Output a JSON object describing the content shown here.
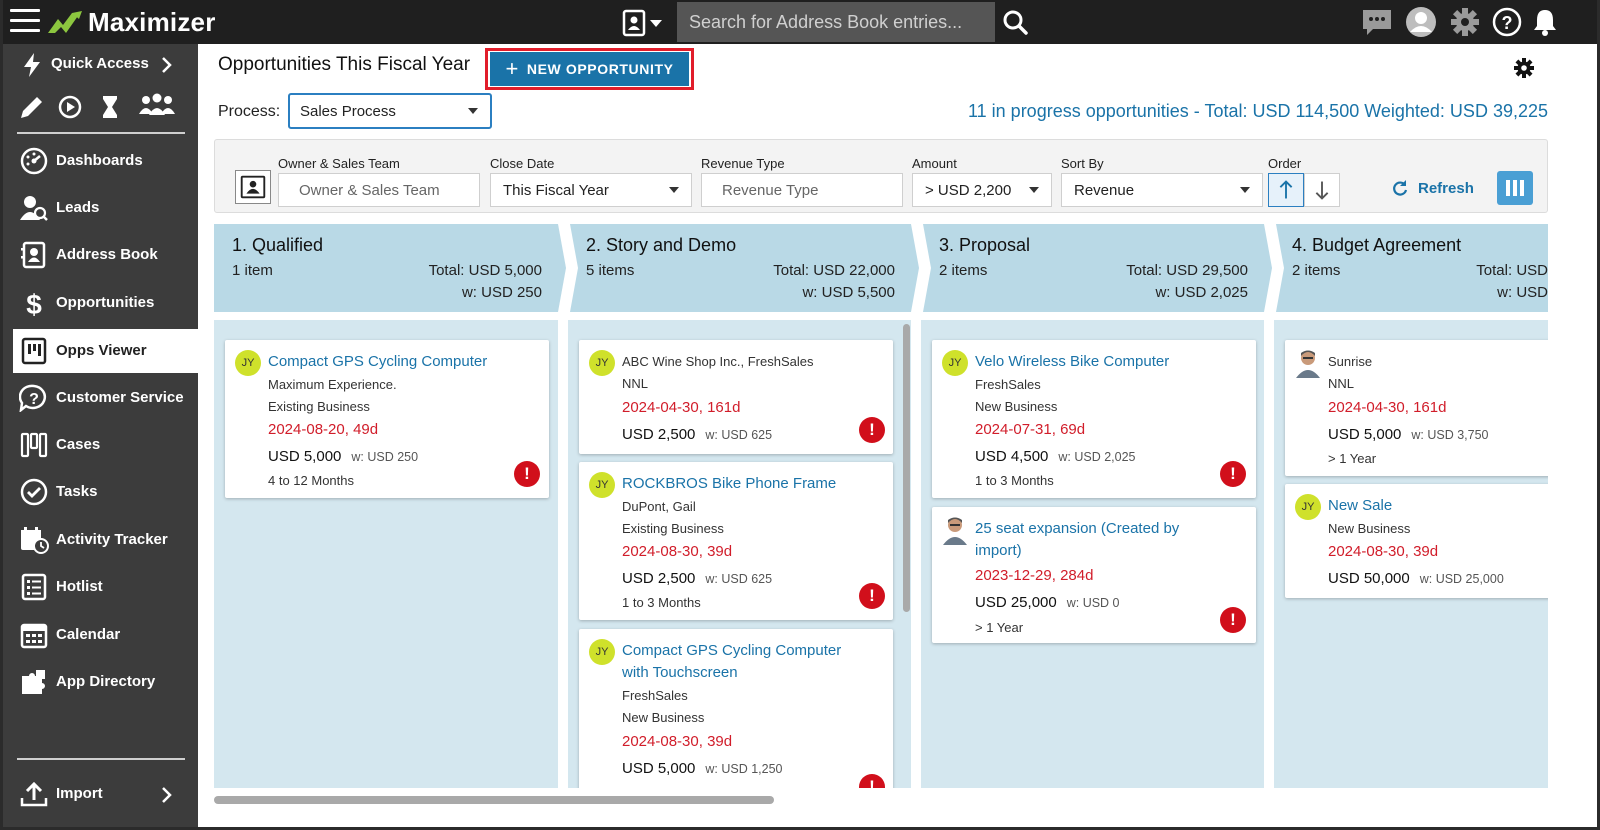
{
  "app": {
    "name": "Maximizer"
  },
  "search": {
    "placeholder": "Search for Address Book entries..."
  },
  "sidebar": {
    "quick_access": "Quick Access",
    "items": [
      {
        "label": "Dashboards"
      },
      {
        "label": "Leads"
      },
      {
        "label": "Address Book"
      },
      {
        "label": "Opportunities"
      },
      {
        "label": "Opps Viewer"
      },
      {
        "label": "Customer Service"
      },
      {
        "label": "Cases"
      },
      {
        "label": "Tasks"
      },
      {
        "label": "Activity Tracker"
      },
      {
        "label": "Hotlist"
      },
      {
        "label": "Calendar"
      },
      {
        "label": "App Directory"
      }
    ],
    "import": "Import"
  },
  "header": {
    "title": "Opportunities This Fiscal Year",
    "new_button": "NEW OPPORTUNITY",
    "process_label": "Process:",
    "process_value": "Sales Process",
    "summary": "11 in progress opportunities - Total: USD 114,500 Weighted: USD 39,225"
  },
  "filters": {
    "owner_label": "Owner & Sales Team",
    "owner_placeholder": "Owner & Sales Team",
    "close_label": "Close Date",
    "close_value": "This Fiscal Year",
    "revenue_label": "Revenue Type",
    "revenue_placeholder": "Revenue Type",
    "amount_label": "Amount",
    "amount_value": "> USD 2,200",
    "sort_label": "Sort By",
    "sort_value": "Revenue",
    "order_label": "Order",
    "refresh": "Refresh"
  },
  "stages": [
    {
      "name": "1. Qualified",
      "count": "1 item",
      "total": "Total: USD 5,000",
      "weighted": "w: USD 250",
      "cards": [
        {
          "initials": "JY",
          "title": "Compact GPS Cycling Computer",
          "line1": "Maximum Experience.",
          "line2": "Existing Business",
          "date": "2024-08-20, 49d",
          "amount": "USD 5,000",
          "w": "w: USD 250",
          "term": "4 to 12 Months"
        }
      ]
    },
    {
      "name": "2. Story and Demo",
      "count": "5 items",
      "total": "Total: USD 22,000",
      "weighted": "w: USD 5,500",
      "cards": [
        {
          "initials": "JY",
          "line1": "ABC Wine Shop Inc., FreshSales",
          "line2": "NNL",
          "date": "2024-04-30, 161d",
          "amount": "USD 2,500",
          "w": "w: USD 625"
        },
        {
          "initials": "JY",
          "title": "ROCKBROS Bike Phone Frame",
          "line1": "DuPont, Gail",
          "line2": "Existing Business",
          "date": "2024-08-30, 39d",
          "amount": "USD 2,500",
          "w": "w: USD 625",
          "term": "1 to 3 Months"
        },
        {
          "initials": "JY",
          "title_a": "Compact GPS Cycling Computer",
          "title_b": "with Touchscreen",
          "line1": "FreshSales",
          "line2": "New Business",
          "date": "2024-08-30, 39d",
          "amount": "USD 5,000",
          "w": "w: USD 1,250"
        }
      ]
    },
    {
      "name": "3. Proposal",
      "count": "2 items",
      "total": "Total: USD 29,500",
      "weighted": "w: USD 2,025",
      "cards": [
        {
          "initials": "JY",
          "title": "Velo Wireless Bike Computer",
          "line1": "FreshSales",
          "line2": "New Business",
          "date": "2024-07-31, 69d",
          "amount": "USD 4,500",
          "w": "w: USD 2,025",
          "term": "1 to 3 Months"
        },
        {
          "title_a": "25 seat expansion (Created by",
          "title_b": "import)",
          "date": "2023-12-29, 284d",
          "amount": "USD 25,000",
          "w": "w: USD 0",
          "term": "> 1 Year"
        }
      ]
    },
    {
      "name": "4. Budget Agreement",
      "count": "2 items",
      "total": "Total: USD",
      "weighted": "w: USD",
      "cards": [
        {
          "line1": "Sunrise",
          "line2": "NNL",
          "date": "2024-04-30, 161d",
          "amount": "USD 5,000",
          "w": "w: USD 3,750",
          "term": "> 1 Year"
        },
        {
          "initials": "JY",
          "title": "New Sale",
          "line1": "New Business",
          "date": "2024-08-30, 39d",
          "amount": "USD 50,000",
          "w": "w: USD 25,000"
        }
      ]
    }
  ]
}
